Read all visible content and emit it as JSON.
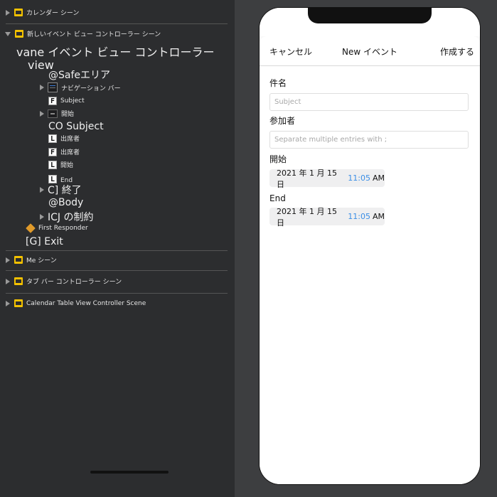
{
  "outline": {
    "calendar_scene": "カレンダー シーン",
    "new_event_scene": "新しいイベント ビュー コントローラー シーン",
    "vc_label": "vane イベント ビュー コントローラー",
    "view_label": "view",
    "safe_area": "@Safeエリア",
    "nav_bar": "ナビゲーション バー",
    "subject_field": "Subject",
    "start_row": "開始",
    "co_subject": "CO Subject",
    "attendees_1": "出席者",
    "attendees_2": "出席者",
    "start_label": "開始",
    "end_label": "End",
    "end_jp": "C] 終了",
    "body": "@Body",
    "constraints": "ICJ の制約",
    "first_responder": "First Responder",
    "exit": "[G] Exit",
    "me_scene": "Me シーン",
    "tabbar_scene": "タブ バー コントローラー シーン",
    "calendar_table_scene": "Calendar Table View Controller Scene",
    "badges": {
      "F": "F",
      "L": "L"
    }
  },
  "phone": {
    "nav": {
      "cancel": "キャンセル",
      "title": "New イベント",
      "create": "作成する"
    },
    "subject_label": "件名",
    "subject_placeholder": "Subject",
    "attendees_label": "参加者",
    "attendees_placeholder": "Separate multiple entries with ;",
    "start_label": "開始",
    "start_date": "2021 年 1 月 15 日",
    "start_time": "11:05",
    "start_ampm": "AM",
    "end_label": "End",
    "end_date": "2021 年 1 月 15 日",
    "end_time": "11:05",
    "end_ampm": "AM"
  },
  "colors": {
    "accent": "#3a8ee6",
    "scene_icon": "#f3c100",
    "outline_bg": "#2c2d2f",
    "canvas_bg": "#3d3e40"
  }
}
